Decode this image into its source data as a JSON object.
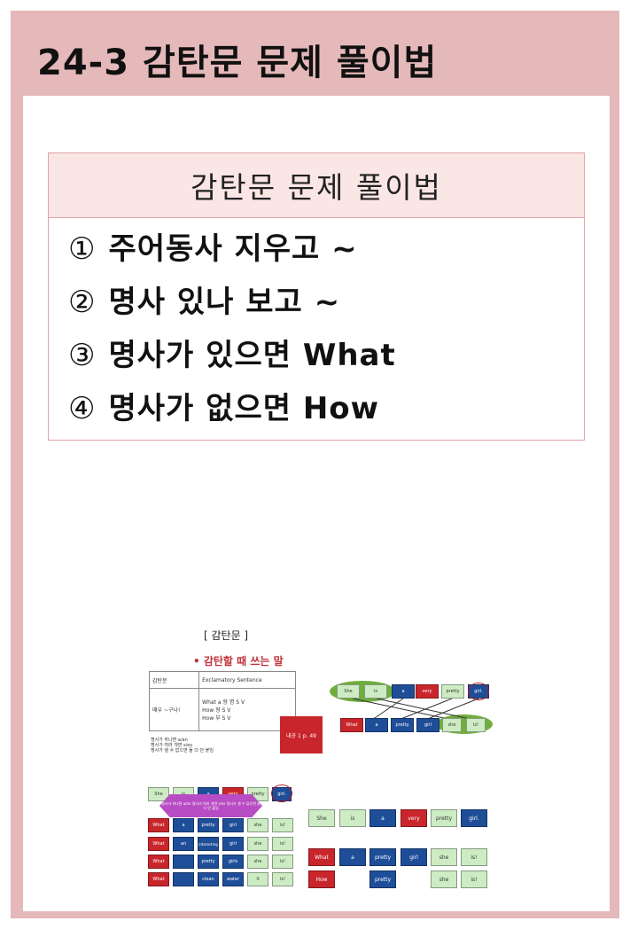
{
  "page_title": "24-3 감탄문 문제 풀이법",
  "box": {
    "heading": "감탄문 문제 풀이법",
    "items": [
      {
        "num": "①",
        "text": "주어동사 지우고 ~"
      },
      {
        "num": "②",
        "text": "명사 있나 보고 ~"
      },
      {
        "num": "③",
        "text": "명사가 있으면 What"
      },
      {
        "num": "④",
        "text": "명사가 없으면 How"
      }
    ]
  },
  "thumbnail": {
    "title": "[ 감탄문 ]",
    "subtitle": "• 감탄할 때 쓰는 말",
    "table": {
      "r1c1": "감탄문",
      "r1c2": "Exclamatory Sentence",
      "r2c1": "매우 ~구나!",
      "r2c2a": "What a 형 명 S V",
      "r2c2b": "How 형 S V",
      "r2c2c": "How 부 S V"
    },
    "notes": [
      "명사가 하나면 a/an",
      "명사가 여러 개면 s/es",
      "명사가 셀 수 없으면 둘 다 안 붙임"
    ],
    "red_note": "내공 1 p. 49",
    "top_row": [
      "She",
      "is",
      "a",
      "very",
      "pretty",
      "girl."
    ],
    "mid_row": [
      "What",
      "a",
      "pretty",
      "girl",
      "she",
      "is!"
    ],
    "grid_top": [
      "She",
      "is",
      "a",
      "very",
      "pretty",
      "girl."
    ],
    "banner": "명사가 하나면 a/an 명사가 여러 개면 s/es 명사가 셀 수 없으면 둘 다 안 붙임",
    "grid_rows": [
      [
        "What",
        "a",
        "pretty",
        "girl",
        "she",
        "is!"
      ],
      [
        "What",
        "an",
        "interesting",
        "girl",
        "she",
        "is!"
      ],
      [
        "What",
        "",
        "pretty",
        "girls",
        "she",
        "is!"
      ],
      [
        "What",
        "",
        "clean",
        "water",
        "it",
        "is!"
      ]
    ],
    "right_top": [
      "She",
      "is",
      "a",
      "very",
      "pretty",
      "girl."
    ],
    "right_what": [
      "What",
      "a",
      "pretty",
      "girl",
      "she",
      "is!"
    ],
    "right_how": [
      "How",
      "",
      "pretty",
      "",
      "she",
      "is!"
    ]
  }
}
